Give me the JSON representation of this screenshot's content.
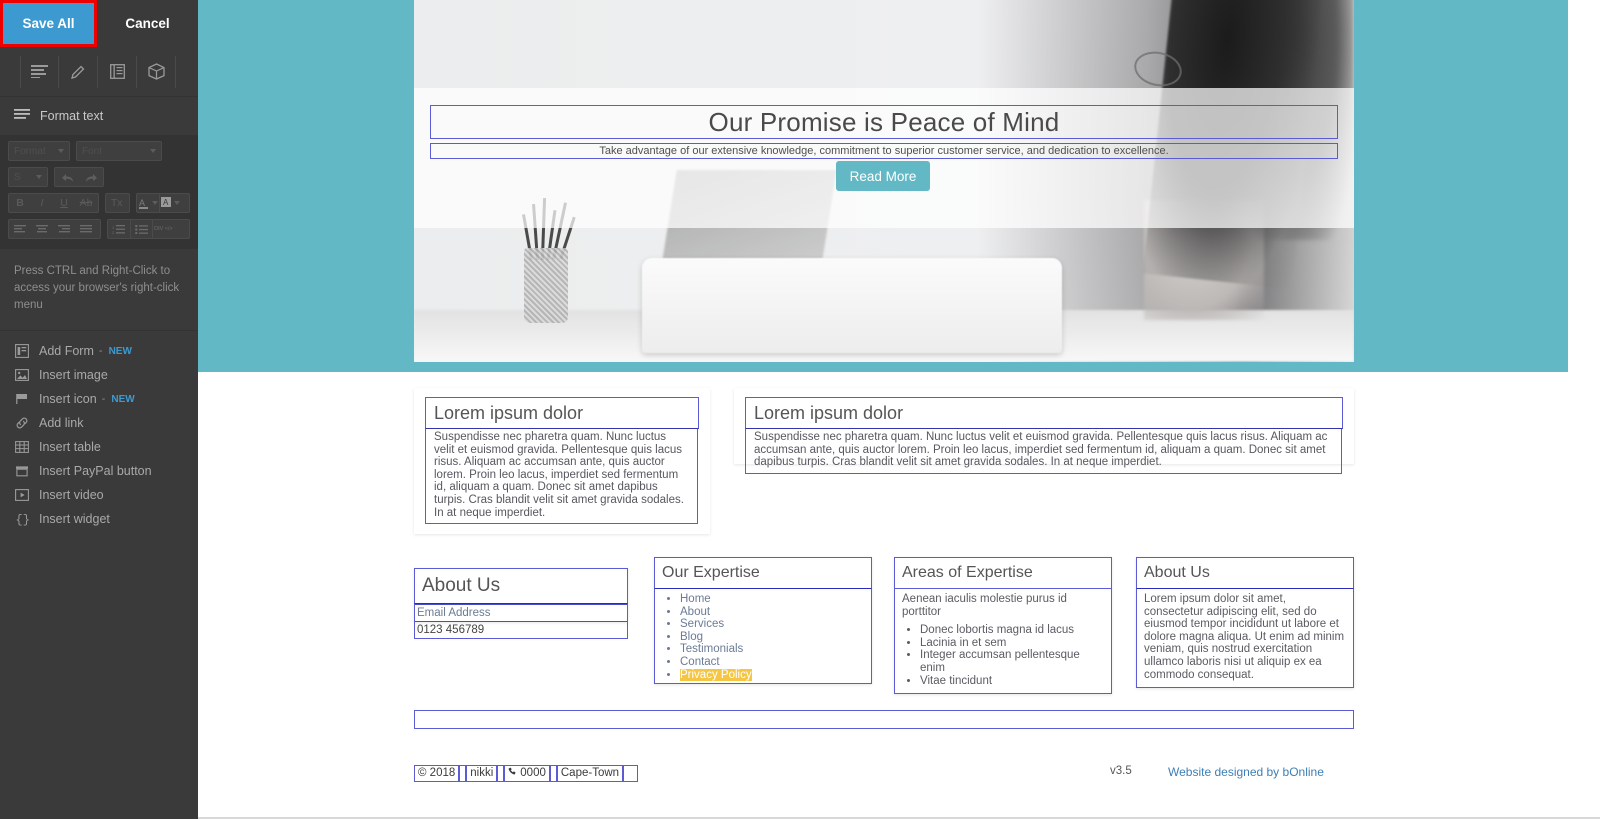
{
  "sidebar": {
    "save_label": "Save All",
    "cancel_label": "Cancel",
    "tool_tabs": [
      {
        "name": "format-text-tab",
        "icon": "text-lines-icon"
      },
      {
        "name": "design-tab",
        "icon": "pencil-icon"
      },
      {
        "name": "layout-tab",
        "icon": "columns-icon"
      },
      {
        "name": "widgets-tab",
        "icon": "cube-icon"
      }
    ],
    "section_title": "Format text",
    "format_toolbar": {
      "format_select": "Format",
      "font_select": "Font",
      "size_select": "S",
      "undo": "undo-icon",
      "redo": "redo-icon",
      "bold": "B",
      "italic": "I",
      "underline": "U",
      "strikethrough": "Ab",
      "clear_format": "Tx",
      "text_color": "A",
      "highlight_color": "A",
      "align_left": "align-left-icon",
      "align_center": "align-center-icon",
      "align_right": "align-right-icon",
      "align_justify": "align-justify-icon",
      "ordered_list": "ordered-list-icon",
      "unordered_list": "unordered-list-icon",
      "code_view": "DIV </>"
    },
    "hint": "Press CTRL and Right-Click to access your browser's right-click menu",
    "menu_items": [
      {
        "label": "Add Form",
        "badge": "NEW",
        "icon": "form-icon"
      },
      {
        "label": "Insert image",
        "badge": "",
        "icon": "image-icon"
      },
      {
        "label": "Insert icon",
        "badge": "NEW",
        "icon": "flag-icon"
      },
      {
        "label": "Add link",
        "badge": "",
        "icon": "link-icon"
      },
      {
        "label": "Insert table",
        "badge": "",
        "icon": "table-icon"
      },
      {
        "label": "Insert PayPal button",
        "badge": "",
        "icon": "paypal-icon"
      },
      {
        "label": "Insert video",
        "badge": "",
        "icon": "video-icon"
      },
      {
        "label": "Insert widget",
        "badge": "",
        "icon": "widget-icon"
      }
    ]
  },
  "colors": {
    "brand_teal": "#62b8c4",
    "save_blue": "#3d9ad1",
    "selection_red": "#ef0000",
    "edit_outline": "#5b5bd6",
    "highlight_yellow": "#f5c544",
    "link_blue": "#3d7fb5"
  },
  "hero": {
    "title": "Our Promise is Peace of Mind",
    "subtitle": "Take advantage of our extensive knowledge, commitment to superior customer service, and dedication to excellence.",
    "button_label": "Read More"
  },
  "lorem_blocks": [
    {
      "title": "Lorem ipsum dolor",
      "body": "Suspendisse nec pharetra quam. Nunc luctus velit et euismod gravida. Pellentesque quis lacus risus. Aliquam ac accumsan ante, quis auctor lorem. Proin leo lacus, imperdiet sed fermentum id, aliquam a quam. Donec sit amet dapibus turpis. Cras blandit velit sit amet gravida sodales. In at neque imperdiet."
    },
    {
      "title": "Lorem ipsum dolor",
      "body": "Suspendisse nec pharetra quam. Nunc luctus velit et euismod gravida. Pellentesque quis lacus risus. Aliquam ac accumsan ante, quis auctor lorem. Proin leo lacus, imperdiet sed fermentum id, aliquam a quam. Donec sit amet dapibus turpis. Cras blandit velit sit amet gravida sodales. In at neque imperdiet."
    }
  ],
  "footer_columns": {
    "about": {
      "title": "About Us",
      "email_line": "Email Address",
      "phone_line": "0123 456789"
    },
    "expertise": {
      "title": "Our Expertise",
      "links": [
        "Home",
        "About",
        "Services",
        "Blog",
        "Testimonials",
        "Contact",
        "Privacy Policy"
      ],
      "highlighted_link": "Privacy Policy"
    },
    "areas": {
      "title": "Areas of Expertise",
      "intro": "Aenean iaculis molestie purus id porttitor",
      "items": [
        "Donec lobortis magna id lacus",
        "Lacinia in et sem",
        "Integer accumsan pellentesque enim",
        "Vitae tincidunt"
      ]
    },
    "about2": {
      "title": "About Us",
      "body": "Lorem ipsum dolor sit amet, consectetur adipiscing elit, sed do eiusmod tempor incididunt ut labore et dolore magna aliqua. Ut enim ad minim veniam, quis nostrud exercitation ullamco laboris nisi ut aliquip ex ea commodo consequat."
    }
  },
  "bottom_bar": {
    "copyright": "© 2018",
    "sep1": "|",
    "company": "nikki",
    "sep2": "|",
    "phone": "0000",
    "phone_icon": "phone-icon",
    "sep3": "|",
    "location": "Cape-Town",
    "version": "v3.5",
    "credit": "Website designed by bOnline"
  }
}
